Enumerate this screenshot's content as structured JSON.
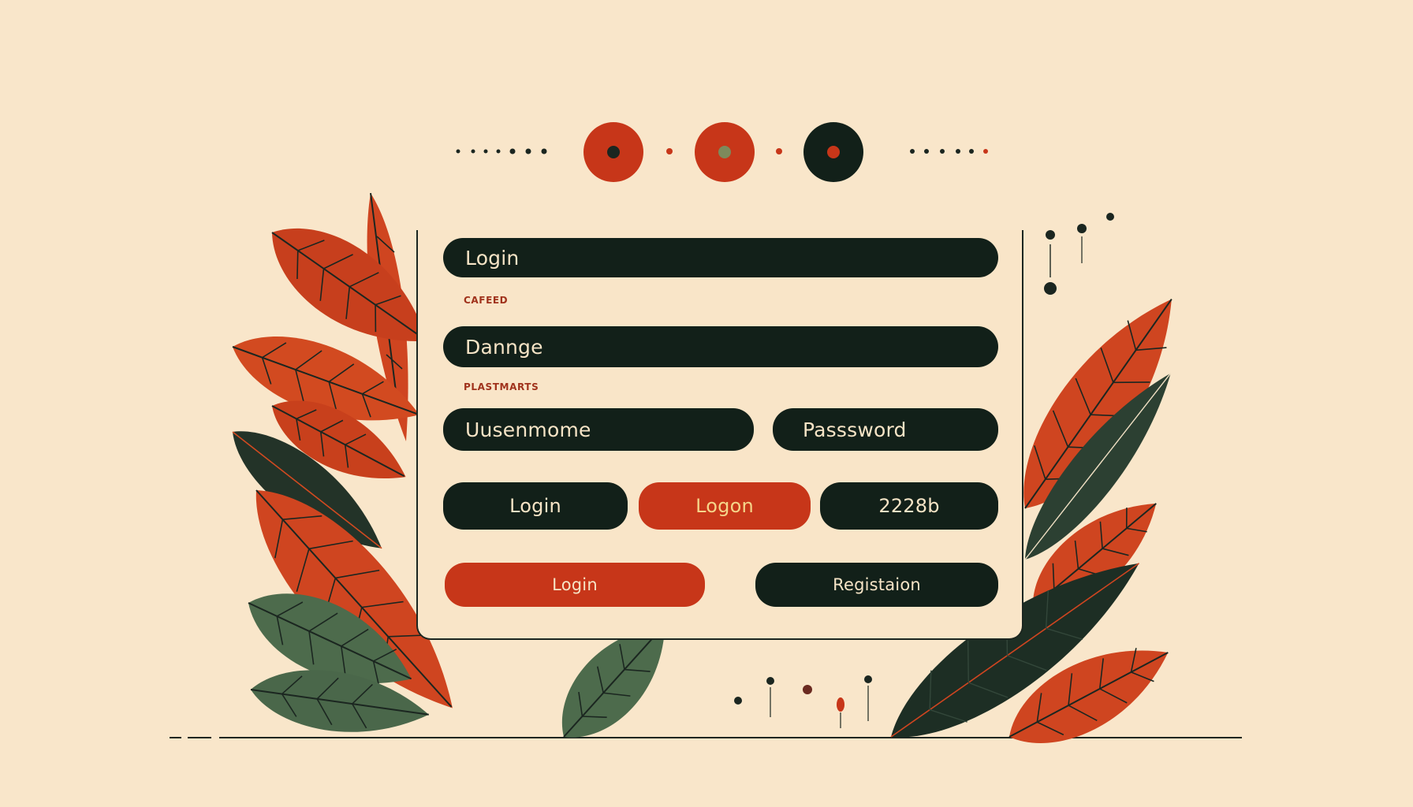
{
  "colors": {
    "background": "#f9e6ca",
    "dark": "#122019",
    "accent_red": "#c73619",
    "leaf_red": "#d24a20",
    "leaf_green": "#4d6b4c",
    "pill_text": "#f6e4c6",
    "label_text": "#a0321c"
  },
  "stepper": {
    "steps": [
      {
        "icon": "red-circle-icon"
      },
      {
        "icon": "red-circle-olive-dot-icon"
      },
      {
        "icon": "dark-circle-red-dot-icon"
      }
    ]
  },
  "form": {
    "header_field": "Login",
    "section_label_1": "CAFEED",
    "field_2": "Dannge",
    "section_label_2": "PLASTMARTS",
    "username_field": "Uusenmome",
    "password_field": "Passsword",
    "buttons_row": [
      "Login",
      "Logon",
      "2228b"
    ],
    "login_button": "Login",
    "register_button": "Registaion"
  },
  "decorations": {
    "left_plant": "leaf-cluster-left",
    "right_plant": "leaf-cluster-right"
  }
}
